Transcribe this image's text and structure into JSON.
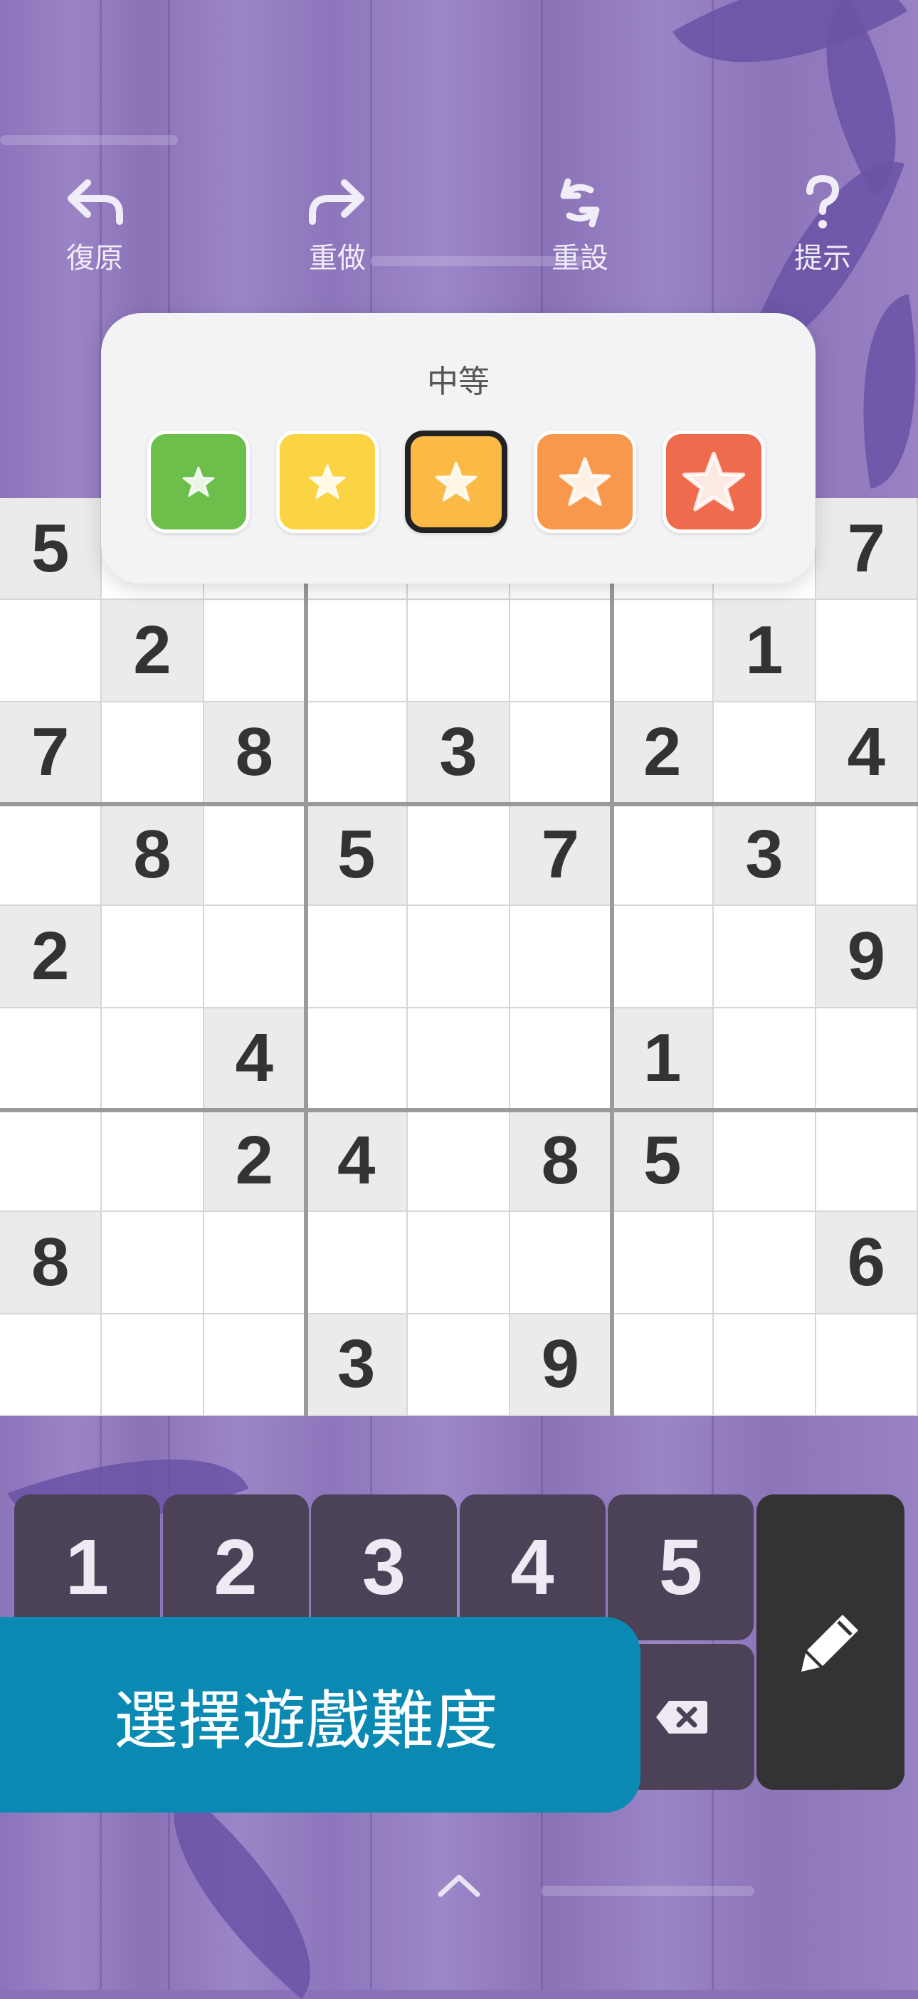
{
  "toolbar": {
    "undo_label": "復原",
    "redo_label": "重做",
    "reset_label": "重設",
    "hint_label": "提示"
  },
  "difficulty_popup": {
    "title": "中等",
    "levels": [
      {
        "icon": "star-icon",
        "color": "#6cbf4a"
      },
      {
        "icon": "star-icon",
        "color": "#fbd443"
      },
      {
        "icon": "star-icon",
        "color": "#fbb945",
        "selected": true
      },
      {
        "icon": "star-icon",
        "color": "#f8984c"
      },
      {
        "icon": "star-icon",
        "color": "#ef6b4e"
      }
    ]
  },
  "board": {
    "rows": [
      [
        "5",
        "",
        "",
        "",
        "",
        "",
        "",
        "",
        "7"
      ],
      [
        "",
        "2",
        "",
        "",
        "",
        "",
        "",
        "1",
        ""
      ],
      [
        "7",
        "",
        "8",
        "",
        "3",
        "",
        "2",
        "",
        "4"
      ],
      [
        "",
        "8",
        "",
        "5",
        "",
        "7",
        "",
        "3",
        ""
      ],
      [
        "2",
        "",
        "",
        "",
        "",
        "",
        "",
        "",
        "9"
      ],
      [
        "",
        "",
        "4",
        "",
        "",
        "",
        "1",
        "",
        ""
      ],
      [
        "",
        "",
        "2",
        "4",
        "",
        "8",
        "5",
        "",
        ""
      ],
      [
        "8",
        "",
        "",
        "",
        "",
        "",
        "",
        "",
        "6"
      ],
      [
        "",
        "",
        "",
        "3",
        "",
        "9",
        "",
        "",
        ""
      ]
    ]
  },
  "keypad": {
    "keys": [
      "1",
      "2",
      "3",
      "4",
      "5"
    ],
    "erase_icon": "backspace-icon",
    "pencil_icon": "pencil-icon"
  },
  "banner": {
    "text": "選擇遊戲難度"
  },
  "bottom": {
    "chevron_icon": "chevron-up-icon"
  },
  "colors": {
    "background": "#8a72b8",
    "banner": "#0a8ab3",
    "key_bg": "#4b4258",
    "pencil_bg": "#333333",
    "given_cell": "#ebebeb"
  }
}
